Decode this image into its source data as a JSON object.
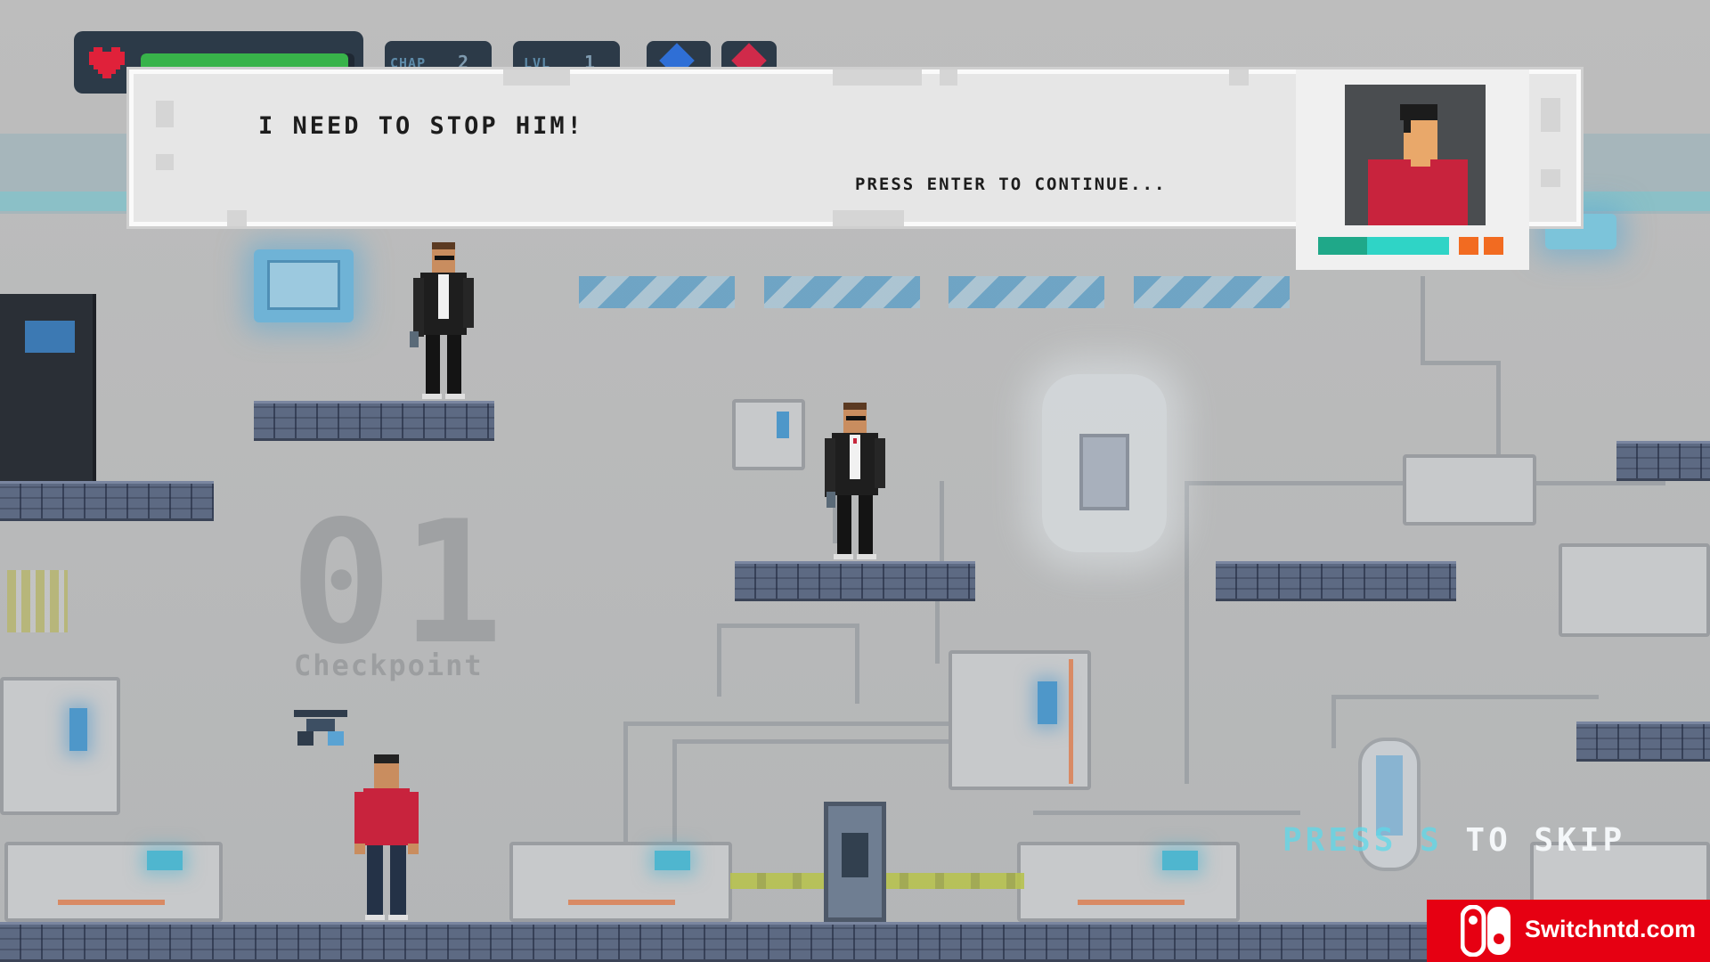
{
  "hud": {
    "health_fraction": 0.97,
    "health_color": "#38b34a",
    "heart_color": "#e0213a",
    "chapter_label": "CHAP",
    "chapter_value": "2",
    "level_label": "LVL",
    "level_value": "1",
    "gem_blue_color": "#2f6fd6",
    "gem_red_color": "#d02a4a"
  },
  "dialog": {
    "text": "I NEED TO STOP HIM!",
    "continue_hint": "PRESS ENTER TO CONTINUE...",
    "speaker_energy_colors": [
      "#1fa889",
      "#2fd4c6",
      "#f26b21",
      "#f26b21"
    ]
  },
  "checkpoint": {
    "number": "01",
    "label": "Checkpoint"
  },
  "skip_hint": {
    "key_part": "PRESS S",
    "rest": "TO SKIP"
  },
  "watermark": {
    "text": "Switchntd.com",
    "color": "#e60012"
  }
}
